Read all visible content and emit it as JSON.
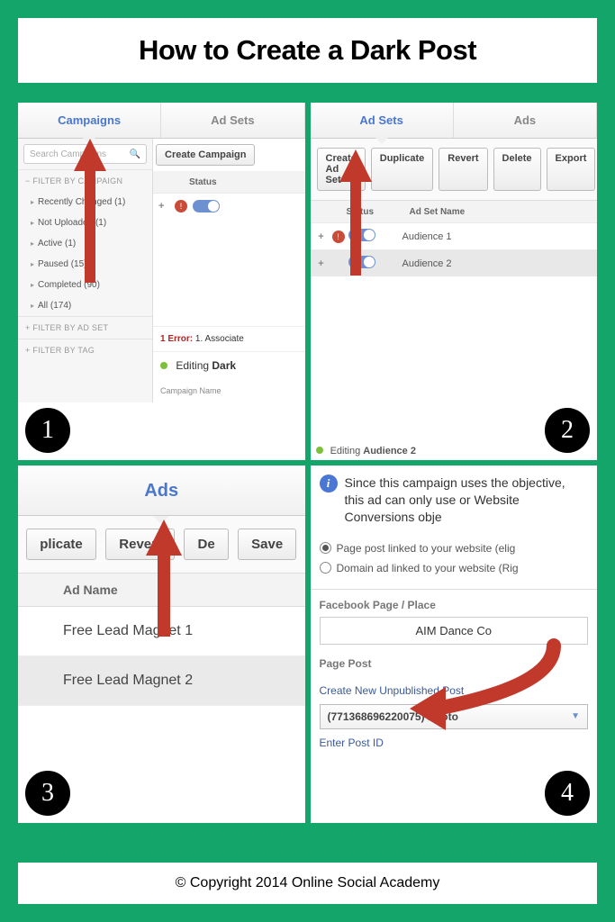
{
  "title": "How to Create a Dark Post",
  "footer": "© Copyright 2014 Online Social Academy",
  "steps": [
    "1",
    "2",
    "3",
    "4"
  ],
  "panel1": {
    "tabs": {
      "campaigns": "Campaigns",
      "adsets": "Ad Sets"
    },
    "search_placeholder": "Search Campaigns",
    "filter_campaign_hdr": "− FILTER BY CAMPAIGN",
    "filter_adset_hdr": "+ FILTER BY AD SET",
    "filter_tag_hdr": "+ FILTER BY TAG",
    "filters": [
      "Recently Changed (1)",
      "Not Uploaded (1)",
      "Active (1)",
      "Paused (15)",
      "Completed (90)",
      "All (174)"
    ],
    "create_btn": "Create Campaign",
    "status_hdr": "Status",
    "error_label": "1 Error:",
    "error_text": "1. Associate",
    "editing_prefix": "Editing ",
    "editing_name": "Dark",
    "campaign_name_label": "Campaign Name"
  },
  "panel2": {
    "tabs": {
      "adsets": "Ad Sets",
      "ads": "Ads"
    },
    "buttons": [
      "Create Ad Set",
      "Duplicate",
      "Revert",
      "Delete",
      "Export"
    ],
    "cols": {
      "status": "Status",
      "name": "Ad Set Name"
    },
    "rows": [
      {
        "name": "Audience 1",
        "warn": true
      },
      {
        "name": "Audience 2",
        "warn": false
      }
    ],
    "editing_prefix": "Editing ",
    "editing_name": "Audience 2"
  },
  "panel3": {
    "tab": "Ads",
    "buttons": [
      "plicate",
      "Revert",
      "De",
      "Save"
    ],
    "col": "Ad Name",
    "rows": [
      "Free Lead Magnet 1",
      "Free Lead Magnet 2"
    ]
  },
  "panel4": {
    "info": "Since this campaign uses the objective, this ad can only use or Website Conversions obje",
    "radios": [
      {
        "label": "Page post linked to your website (elig",
        "checked": true
      },
      {
        "label": "Domain ad linked to your website (Rig",
        "checked": false
      }
    ],
    "page_label": "Facebook Page / Place",
    "page_value": "AIM Dance Co",
    "post_label": "Page Post",
    "create_link": "Create New Unpublished Post",
    "select_value": "(771368696220075) Photo",
    "enter_id": "Enter Post ID"
  }
}
